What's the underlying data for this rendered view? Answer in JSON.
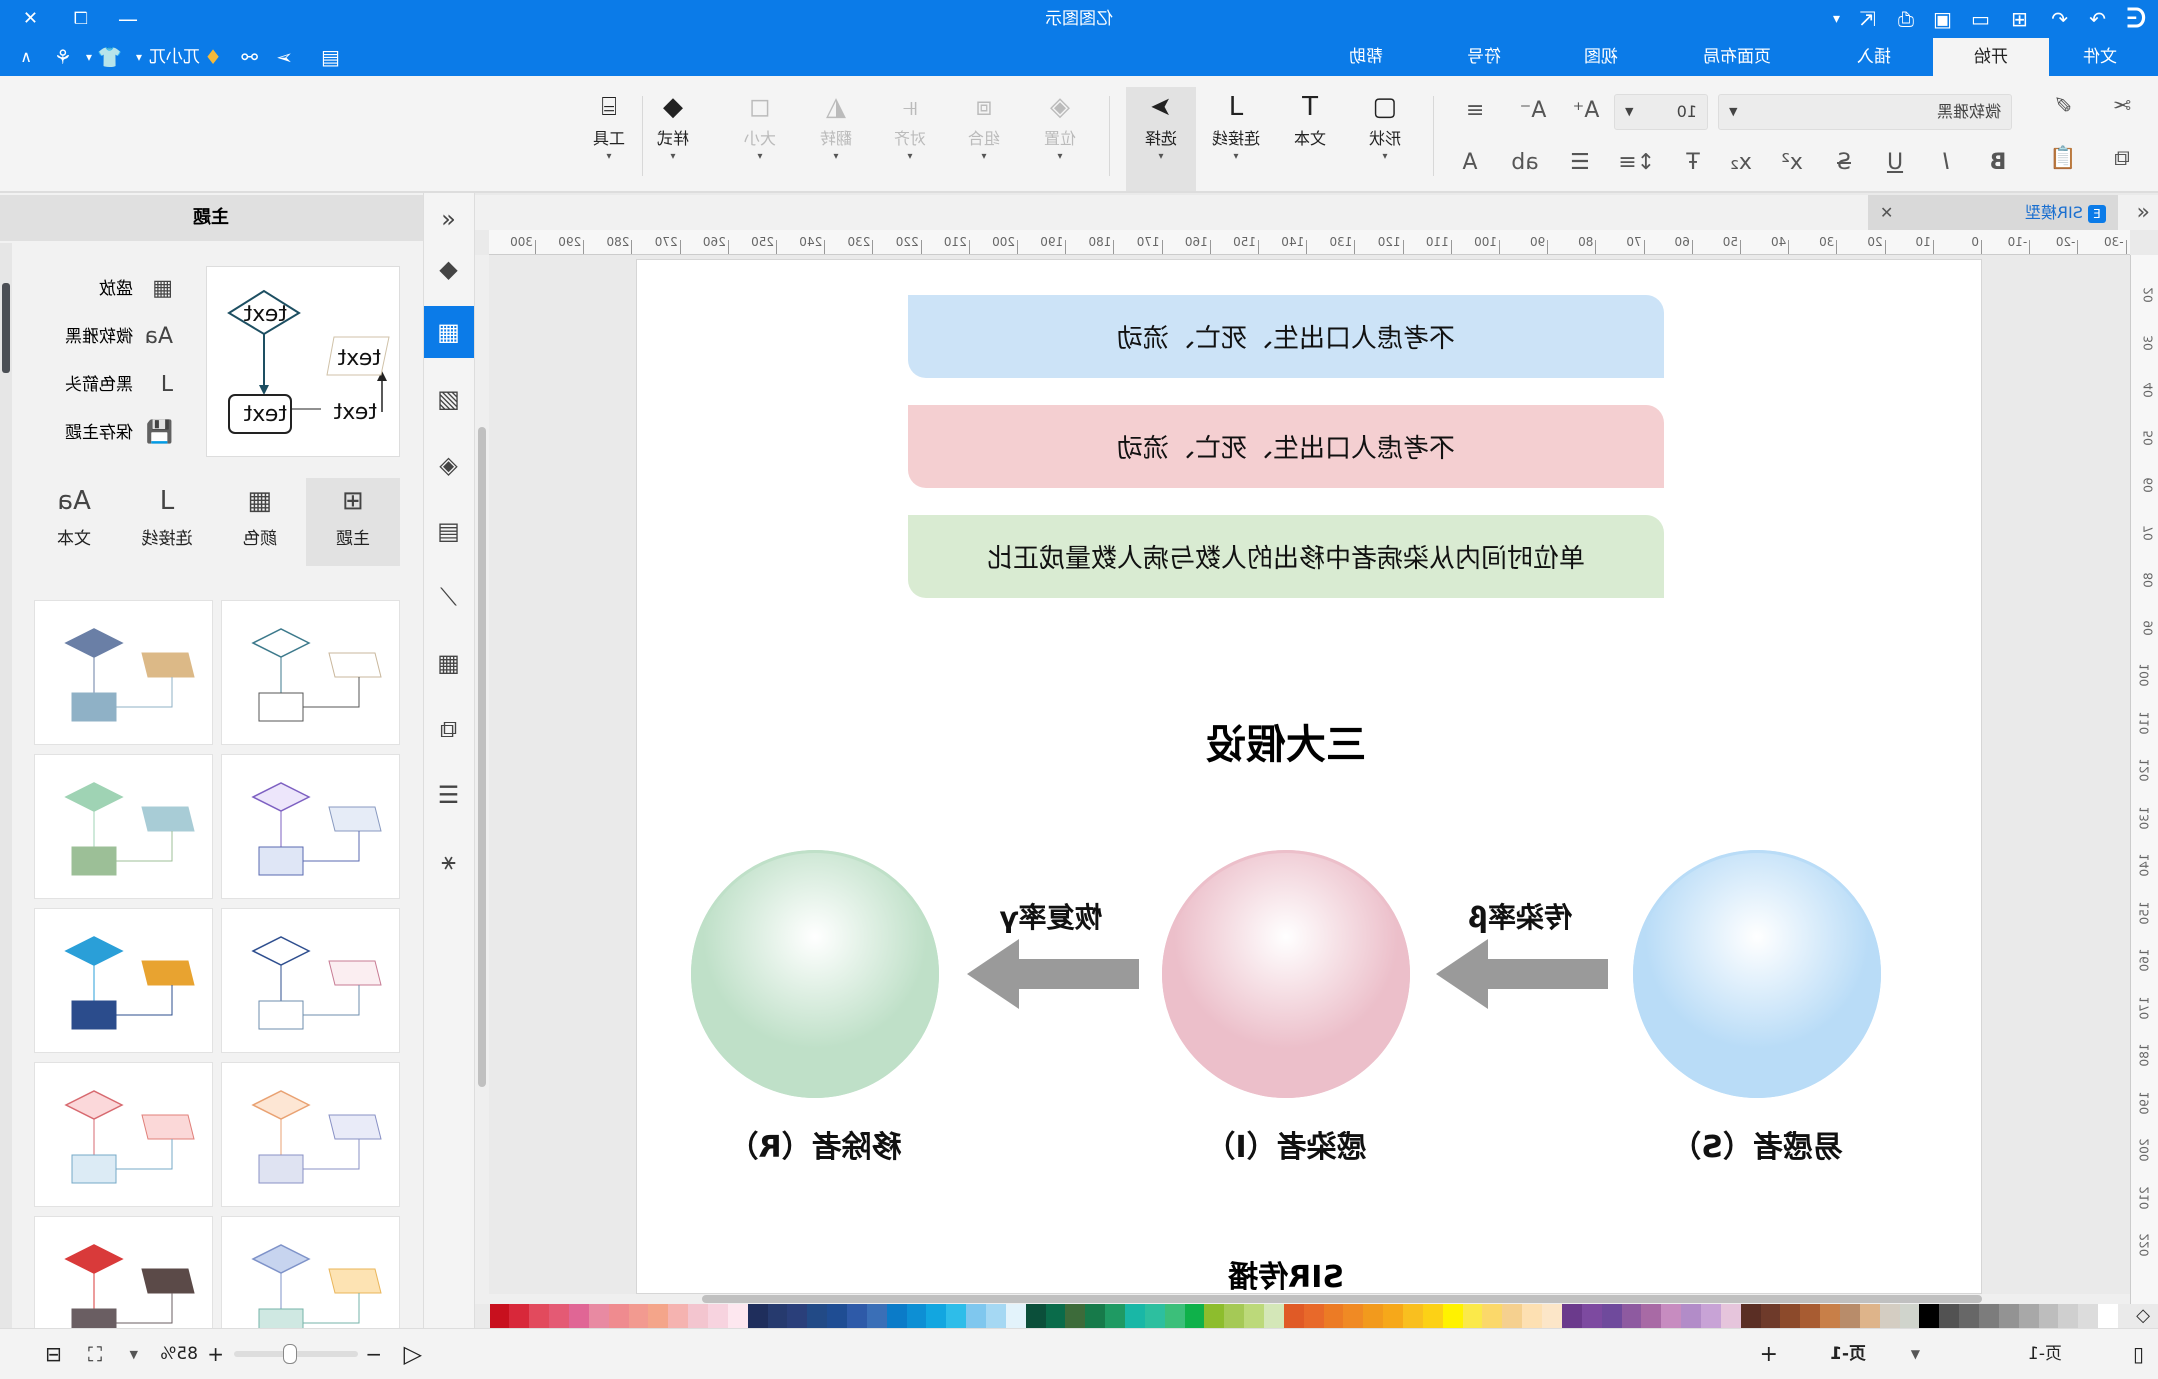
{
  "titlebar": {
    "title": "亿图图示",
    "minimize": "—",
    "restore": "❐",
    "close": "✕"
  },
  "tabs": [
    {
      "label": "文件"
    },
    {
      "label": "开始",
      "active": true
    },
    {
      "label": "插入"
    },
    {
      "label": "页面布局"
    },
    {
      "label": "视图"
    },
    {
      "label": "符号"
    },
    {
      "label": "帮助"
    }
  ],
  "account": {
    "name": "兀小兀"
  },
  "ribbon": {
    "font_family": "微软雅黑",
    "font_size": "10",
    "shape": "形状",
    "text": "文本",
    "connector": "连接线",
    "select": "选择",
    "position": "位置",
    "group": "组合",
    "align": "对齐",
    "flip": "翻转",
    "size": "大小",
    "style": "样式",
    "tools": "工具"
  },
  "document": {
    "tab": "SIR模型"
  },
  "ruler": {
    "h": [
      "-30",
      "-20",
      "-10",
      "0",
      "10",
      "20",
      "30",
      "40",
      "50",
      "60",
      "70",
      "80",
      "90",
      "100",
      "110",
      "120",
      "130",
      "140",
      "150",
      "160",
      "170",
      "180",
      "190",
      "200",
      "210",
      "220",
      "230",
      "240",
      "250",
      "260",
      "270",
      "280",
      "290",
      "300"
    ],
    "v": [
      "20",
      "30",
      "40",
      "50",
      "60",
      "70",
      "80",
      "90",
      "100",
      "110",
      "120",
      "130",
      "140",
      "150",
      "160",
      "170",
      "180",
      "190",
      "200",
      "210",
      "220"
    ]
  },
  "diagram": {
    "assumptions": [
      "不考虑人口出生、死亡、流动",
      "不考虑人口出生、死亡、流动",
      "单位时间内从染病者中移出的人数与病人数量成正比"
    ],
    "assumption_colors": [
      "#cce3f7",
      "#f4cfd1",
      "#d9ebd2"
    ],
    "heading": "三大假设",
    "nodes": [
      {
        "label": "易感者（S）",
        "color": "#b9dcf7"
      },
      {
        "label": "感染者（I）",
        "color": "#ecbfca"
      },
      {
        "label": "移除者（R）",
        "color": "#bfe0c8"
      }
    ],
    "edges": [
      {
        "label": "传染率β"
      },
      {
        "label": "恢复率γ"
      }
    ],
    "footer": "SIR传播"
  },
  "side_icons": [
    "collapse-icon",
    "fill-icon",
    "theme-icon",
    "image-icon",
    "layers-icon",
    "page-icon",
    "chart-icon",
    "table-icon",
    "gallery-icon",
    "format-icon",
    "mindmap-icon"
  ],
  "panel": {
    "title": "主题",
    "options": [
      {
        "label": "盛放",
        "icon": "palette-icon"
      },
      {
        "label": "微软雅黑",
        "icon": "font-icon"
      },
      {
        "label": "黑色箭头",
        "icon": "connector-icon"
      },
      {
        "label": "保存主题",
        "icon": "save-icon"
      }
    ],
    "preview_text": "text",
    "bottom_tabs": [
      {
        "label": "主题",
        "active": true
      },
      {
        "label": "颜色"
      },
      {
        "label": "连接线"
      },
      {
        "label": "文本"
      }
    ],
    "themes": [
      {
        "d": "#ffffff",
        "ds": "#3d7a8c",
        "p": "#ffffff",
        "ps": "#c9b79c",
        "r": "#ffffff",
        "rs": "#555555"
      },
      {
        "d": "#6a7fa6",
        "ds": "#6a7fa6",
        "p": "#dcb987",
        "ps": "#dcb987",
        "r": "#8fb1c6",
        "rs": "#8fb1c6"
      },
      {
        "d": "#ede6fb",
        "ds": "#7e61c2",
        "p": "#e6ecf7",
        "ps": "#8899c0",
        "r": "#dfe6f6",
        "rs": "#5a6ab0"
      },
      {
        "d": "#9fd3b4",
        "ds": "#9fd3b4",
        "p": "#a8ccd6",
        "ps": "#a8ccd6",
        "r": "#9cbf97",
        "rs": "#9cbf97"
      },
      {
        "d": "#ffffff",
        "ds": "#2f4f8f",
        "p": "#fbeef1",
        "ps": "#c77b93",
        "r": "#ffffff",
        "rs": "#6e8eae"
      },
      {
        "d": "#2a9fd8",
        "ds": "#2a9fd8",
        "p": "#e8a330",
        "ps": "#e8a330",
        "r": "#2b4c8c",
        "rs": "#2b4c8c"
      },
      {
        "d": "#fde6d4",
        "ds": "#e9a273",
        "p": "#e9ebf8",
        "ps": "#8890c5",
        "r": "#dfe3f2",
        "rs": "#8890c5"
      },
      {
        "d": "#fbd8da",
        "ds": "#d76a70",
        "p": "#fbd8d8",
        "ps": "#e07f79",
        "r": "#dcebf5",
        "rs": "#75a8c7"
      },
      {
        "d": "#c7d4ef",
        "ds": "#7f93c9",
        "p": "#fde3b3",
        "ps": "#e9b55a",
        "r": "#cfe8e2",
        "rs": "#76b3a8"
      },
      {
        "d": "#d93a3a",
        "ds": "#d93a3a",
        "p": "#5b4a48",
        "ps": "#5b4a48",
        "r": "#6a5e62",
        "rs": "#6a5e62"
      }
    ]
  },
  "palette": [
    "#ffffff",
    "#dcdcdc",
    "#cfcfcf",
    "#bdbdbd",
    "#a8a8a8",
    "#939393",
    "#7c7c7c",
    "#676767",
    "#525252",
    "#000000",
    "#d0d4cc",
    "#d4cdc2",
    "#deb48a",
    "#b88c6a",
    "#c87f48",
    "#a85c32",
    "#8c4a2b",
    "#6e3a2a",
    "#5a2e24",
    "#e6c5dc",
    "#c8a3d6",
    "#b28cc8",
    "#c78cc0",
    "#a86aa5",
    "#8e5aa0",
    "#6f4a9c",
    "#7d4aa0",
    "#6b3a8c",
    "#fce6c8",
    "#fde0b2",
    "#f5d08f",
    "#fbd86a",
    "#fbe94a",
    "#fff200",
    "#fcd116",
    "#f9bf1f",
    "#f6a81a",
    "#f29a1d",
    "#f08a24",
    "#ec7b25",
    "#e8692a",
    "#e05a26",
    "#d4e7b8",
    "#bcd97a",
    "#a5c956",
    "#8dbd2d",
    "#0fb14a",
    "#3cbf7a",
    "#2dbf9f",
    "#19b7a6",
    "#1f9a63",
    "#177a4a",
    "#3d6b3a",
    "#0a6b4a",
    "#0b4f3a",
    "#e3f3fb",
    "#a5d8f3",
    "#7fc7ee",
    "#2ebde9",
    "#12a6e0",
    "#0d8fd4",
    "#0b7bc8",
    "#3a6fb7",
    "#2e5aa8",
    "#1f4d93",
    "#224a86",
    "#2a3f7a",
    "#263a6e",
    "#1f2e5c",
    "#fde7ef",
    "#f7d3df",
    "#f3c5cf",
    "#f5b3b0",
    "#f4a58a",
    "#f29a90",
    "#ef8b8f",
    "#e88aa2",
    "#e06695",
    "#e45a74",
    "#e24a5d",
    "#d8283a",
    "#c8101e"
  ],
  "statusbar": {
    "page_tab": "页-1",
    "page_current": "页-1",
    "add_page": "+",
    "zoom": "85%",
    "zoom_level": 0.55
  }
}
